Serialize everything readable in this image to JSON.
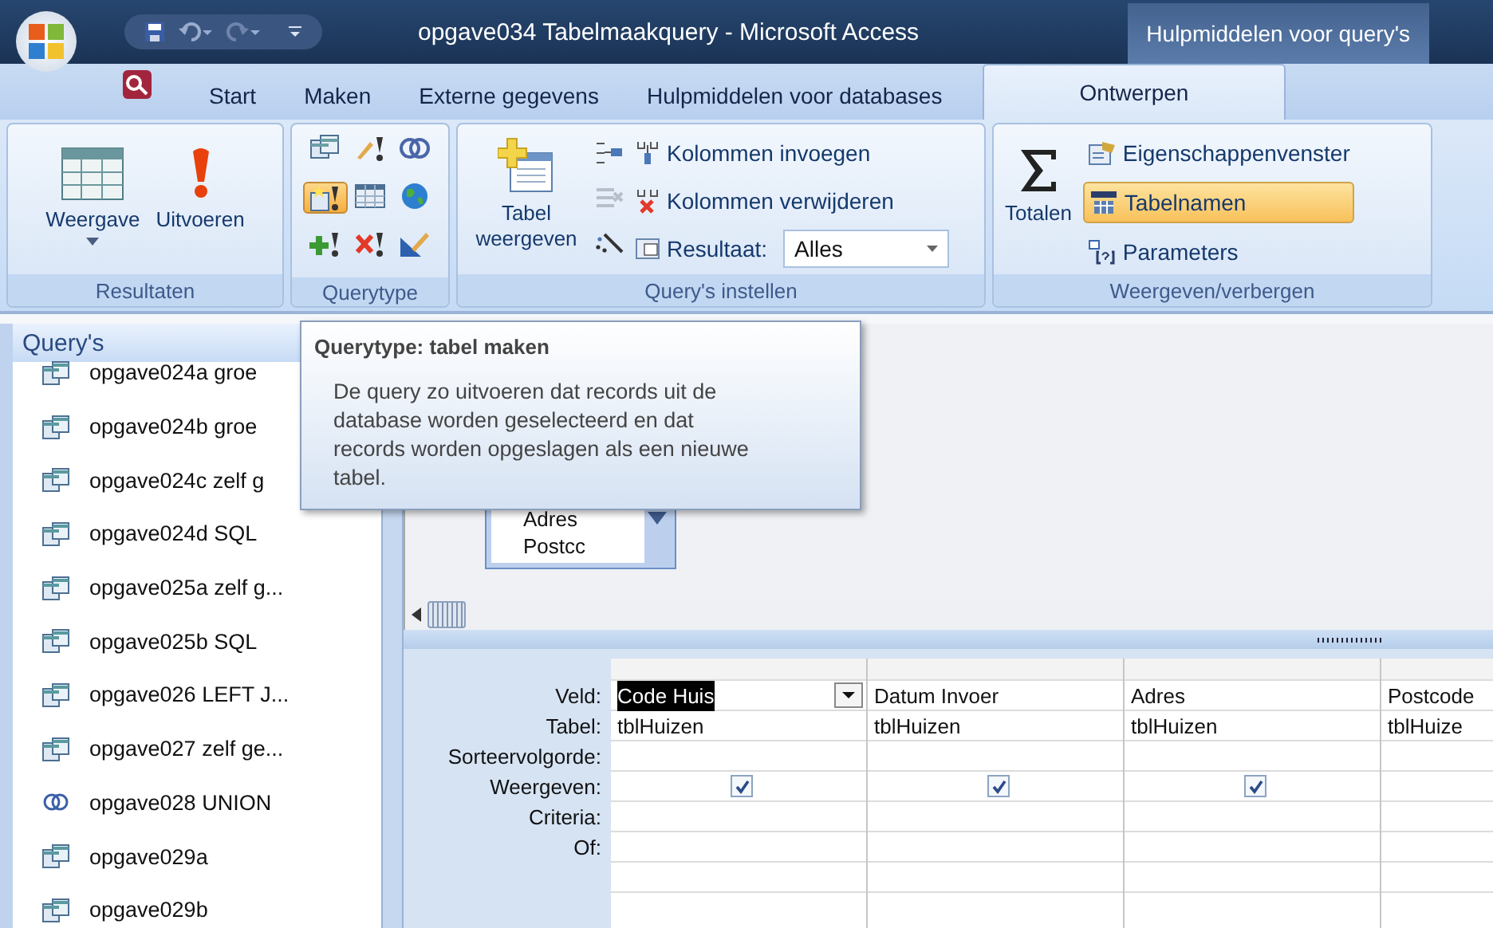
{
  "window": {
    "title": "opgave034 Tabelmaakquery - Microsoft Access",
    "context_tab": "Hulpmiddelen voor query's"
  },
  "tabs": [
    {
      "label": "Start",
      "selected": false
    },
    {
      "label": "Maken",
      "selected": false
    },
    {
      "label": "Externe gegevens",
      "selected": false
    },
    {
      "label": "Hulpmiddelen voor databases",
      "selected": false
    },
    {
      "label": "Ontwerpen",
      "selected": true
    }
  ],
  "ribbon": {
    "resultaten": {
      "label": "Resultaten",
      "buttons": [
        {
          "kind": "view",
          "label": "Weergave"
        },
        {
          "kind": "run",
          "label": "Uitvoeren"
        }
      ]
    },
    "querytype": {
      "label": "Querytype",
      "buttons": [
        {
          "kind": "select",
          "selected": false
        },
        {
          "kind": "update",
          "selected": false
        },
        {
          "kind": "union",
          "selected": false
        },
        {
          "kind": "make-table",
          "selected": true
        },
        {
          "kind": "crosstab",
          "selected": false
        },
        {
          "kind": "pass-through",
          "selected": false
        },
        {
          "kind": "append",
          "selected": false
        },
        {
          "kind": "delete",
          "selected": false
        },
        {
          "kind": "data-definition",
          "selected": false
        }
      ]
    },
    "instellen": {
      "label": "Query's instellen",
      "show_table": "Tabel weergeven",
      "insert_columns": "Kolommen invoegen",
      "delete_columns": "Kolommen verwijderen",
      "result_label": "Resultaat:",
      "result_value": "Alles"
    },
    "weergeven": {
      "label": "Weergeven/verbergen",
      "totals": "Totalen",
      "items": [
        {
          "kind": "properties",
          "label": "Eigenschappenvenster",
          "selected": false
        },
        {
          "kind": "table-names",
          "label": "Tabelnamen",
          "selected": true
        },
        {
          "kind": "parameters",
          "label": "Parameters",
          "selected": false
        }
      ]
    }
  },
  "navigation": {
    "title": "Query's",
    "items": [
      {
        "kind": "select",
        "label": "opgave024a groe"
      },
      {
        "kind": "select",
        "label": "opgave024b groe"
      },
      {
        "kind": "select",
        "label": "opgave024c zelf g"
      },
      {
        "kind": "select",
        "label": "opgave024d SQL"
      },
      {
        "kind": "select",
        "label": "opgave025a zelf g..."
      },
      {
        "kind": "select",
        "label": "opgave025b SQL"
      },
      {
        "kind": "select",
        "label": "opgave026 LEFT J..."
      },
      {
        "kind": "select",
        "label": "opgave027 zelf ge..."
      },
      {
        "kind": "union",
        "label": "opgave028 UNION"
      },
      {
        "kind": "select",
        "label": "opgave029a"
      },
      {
        "kind": "select",
        "label": "opgave029b"
      }
    ]
  },
  "tooltip": {
    "title": "Querytype: tabel maken",
    "text": "De query zo uitvoeren dat records uit de database worden geselecteerd en dat records worden opgeslagen als een nieuwe tabel."
  },
  "table_box": {
    "fields": [
      "Adres",
      "Postcc"
    ]
  },
  "grid": {
    "row_labels": [
      "Veld:",
      "Tabel:",
      "Sorteervolgorde:",
      "Weergeven:",
      "Criteria:",
      "Of:"
    ],
    "columns": [
      {
        "field": "Code Huis",
        "table": "tblHuizen",
        "selected": true,
        "show": true
      },
      {
        "field": "Datum Invoer",
        "table": "tblHuizen",
        "selected": false,
        "show": true
      },
      {
        "field": "Adres",
        "table": "tblHuizen",
        "selected": false,
        "show": true
      },
      {
        "field": "Postcode",
        "table": "tblHuize",
        "selected": false
      }
    ]
  }
}
